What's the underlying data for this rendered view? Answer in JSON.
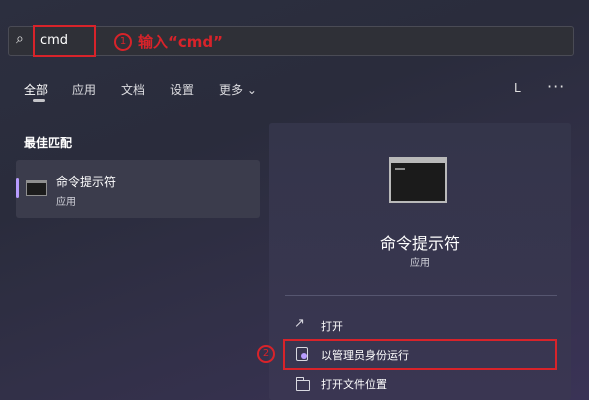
{
  "search": {
    "value": "cmd"
  },
  "annotation": {
    "step1_number": "1",
    "step1_text": "输入“cmd”",
    "step2_number": "2"
  },
  "tabs": [
    {
      "label": "全部"
    },
    {
      "label": "应用"
    },
    {
      "label": "文档"
    },
    {
      "label": "设置"
    },
    {
      "label": "更多 ⌄"
    }
  ],
  "user_initial": "L",
  "more_menu": "···",
  "best_match": {
    "section_title": "最佳匹配",
    "name": "命令提示符",
    "type": "应用"
  },
  "details": {
    "name": "命令提示符",
    "type": "应用",
    "actions": [
      {
        "label": "打开",
        "icon": "open-icon"
      },
      {
        "label": "以管理员身份运行",
        "icon": "shield-icon"
      },
      {
        "label": "打开文件位置",
        "icon": "folder-icon"
      }
    ]
  },
  "colors": {
    "annotation_red": "#d8232a",
    "accent": "#b89cff"
  }
}
